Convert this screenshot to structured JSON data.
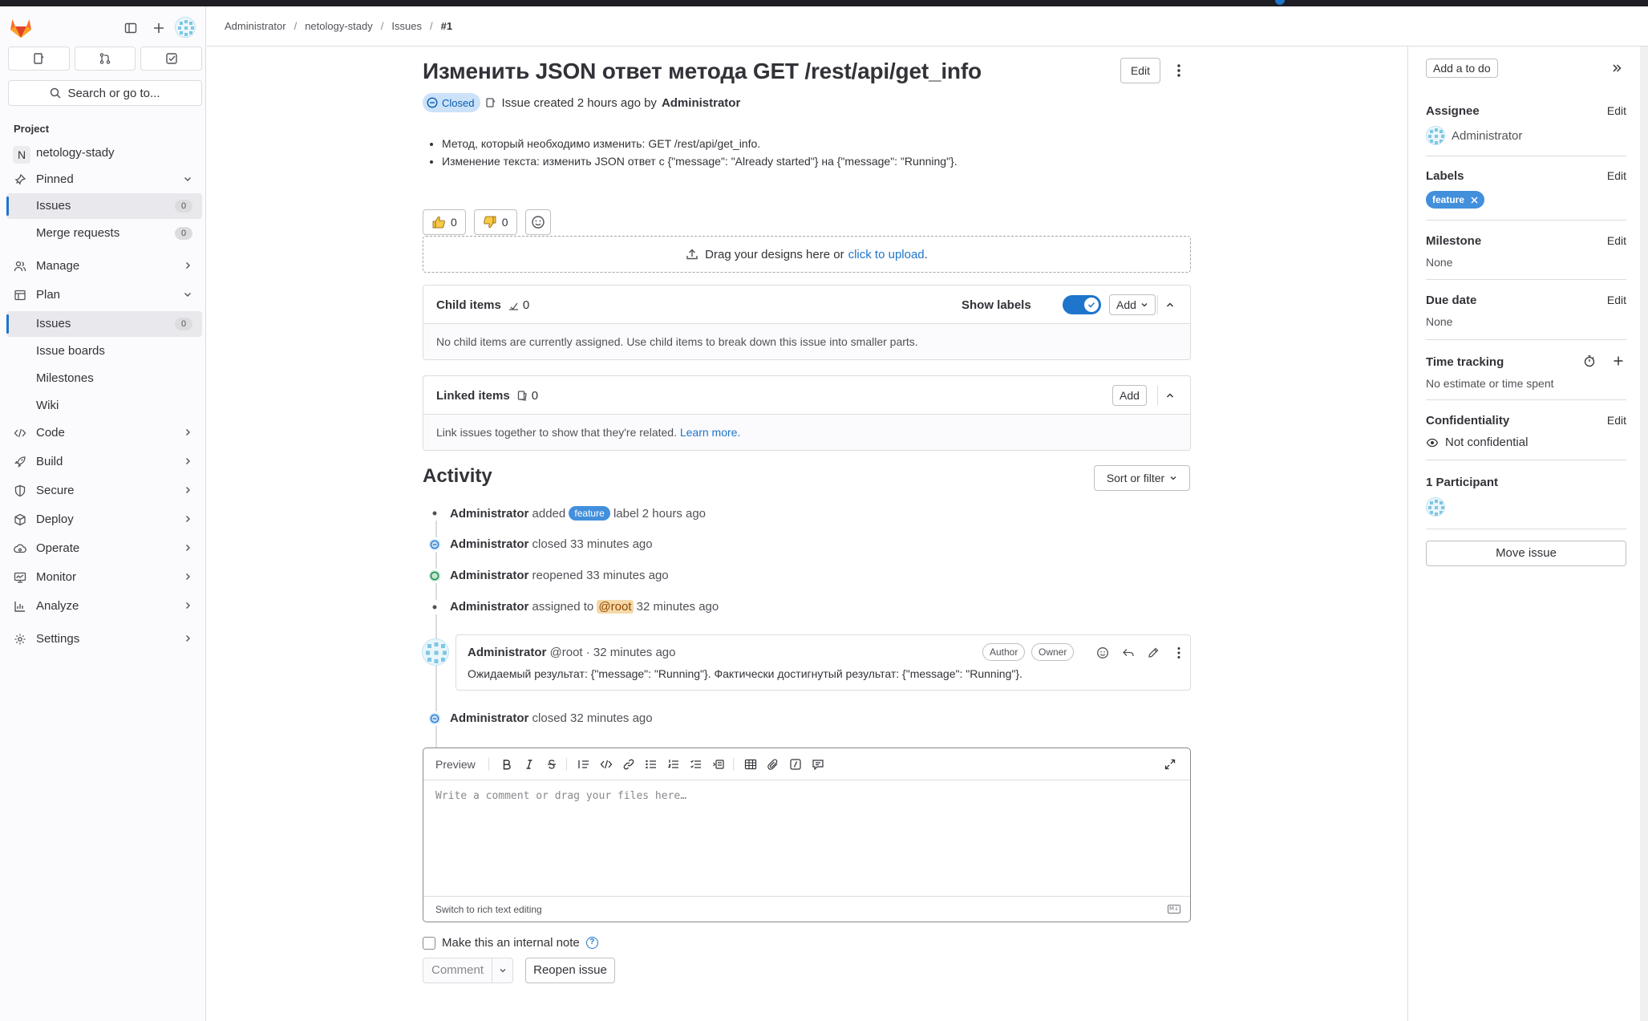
{
  "breadcrumb": [
    "Administrator",
    "netology-stady",
    "Issues",
    "#1"
  ],
  "sidebar": {
    "search_placeholder": "Search or go to...",
    "section": "Project",
    "project_initial": "N",
    "project_name": "netology-stady",
    "pinned": "Pinned",
    "pinned_items": [
      {
        "label": "Issues",
        "count": "0"
      },
      {
        "label": "Merge requests",
        "count": "0"
      }
    ],
    "manage": "Manage",
    "plan": "Plan",
    "plan_items": [
      {
        "label": "Issues",
        "count": "0"
      },
      {
        "label": "Issue boards"
      },
      {
        "label": "Milestones"
      },
      {
        "label": "Wiki"
      }
    ],
    "groups": [
      "Code",
      "Build",
      "Secure",
      "Deploy",
      "Operate",
      "Monitor",
      "Analyze"
    ],
    "settings": "Settings"
  },
  "issue": {
    "title": "Изменить JSON ответ метода GET /rest/api/get_info",
    "edit_label": "Edit",
    "status": "Closed",
    "created_text": "Issue created 2 hours ago by",
    "author": "Administrator",
    "description": [
      "Метод, который необходимо изменить: GET /rest/api/get_info.",
      "Изменение текста: изменить JSON ответ с {\"message\": \"Already started\"} на {\"message\": \"Running\"}."
    ],
    "thumbs_up": "0",
    "thumbs_down": "0"
  },
  "designs": {
    "text": "Drag your designs here or",
    "link": "click to upload",
    "period": "."
  },
  "child_items": {
    "title": "Child items",
    "count": "0",
    "show_labels": "Show labels",
    "add_label": "Add",
    "empty": "No child items are currently assigned. Use child items to break down this issue into smaller parts."
  },
  "linked_items": {
    "title": "Linked items",
    "count": "0",
    "add_label": "Add",
    "empty": "Link issues together to show that they're related.",
    "learn_more": "Learn more."
  },
  "activity": {
    "title": "Activity",
    "sort_label": "Sort or filter",
    "events": [
      {
        "actor": "Administrator",
        "pre": "added",
        "label": "feature",
        "post": "label 2 hours ago"
      },
      {
        "actor": "Administrator",
        "text": "closed 33 minutes ago"
      },
      {
        "actor": "Administrator",
        "text": "reopened 33 minutes ago"
      },
      {
        "actor": "Administrator",
        "pre": "assigned to",
        "mention": "@root",
        "post": "32 minutes ago"
      },
      {
        "actor": "Administrator",
        "text": "closed 32 minutes ago"
      }
    ],
    "comment": {
      "author": "Administrator",
      "handle": "@root · 32 minutes ago",
      "role_author": "Author",
      "role_owner": "Owner",
      "body": "Ожидаемый результат: {\"message\": \"Running\"}. Фактически достигнутый результат: {\"message\": \"Running\"}."
    }
  },
  "editor": {
    "preview": "Preview",
    "placeholder": "Write a comment or drag your files here…",
    "switch": "Switch to rich text editing",
    "md": "M↓",
    "internal_note": "Make this an internal note",
    "comment_btn": "Comment",
    "reopen_btn": "Reopen issue"
  },
  "right_sidebar": {
    "todo": "Add a to do",
    "edit": "Edit",
    "assignee_h": "Assignee",
    "assignee": "Administrator",
    "labels_h": "Labels",
    "label": "feature",
    "milestone_h": "Milestone",
    "milestone": "None",
    "due_h": "Due date",
    "due": "None",
    "time_h": "Time tracking",
    "time": "No estimate or time spent",
    "conf_h": "Confidentiality",
    "conf": "Not confidential",
    "participants_h": "1 Participant",
    "move": "Move issue"
  },
  "colors": {
    "accent": "#1f75cb",
    "label_feature": "#428fdc",
    "closed_badge_bg": "#cbe2f9",
    "reopened": "#108548",
    "mention_bg": "#f5d9a8"
  }
}
